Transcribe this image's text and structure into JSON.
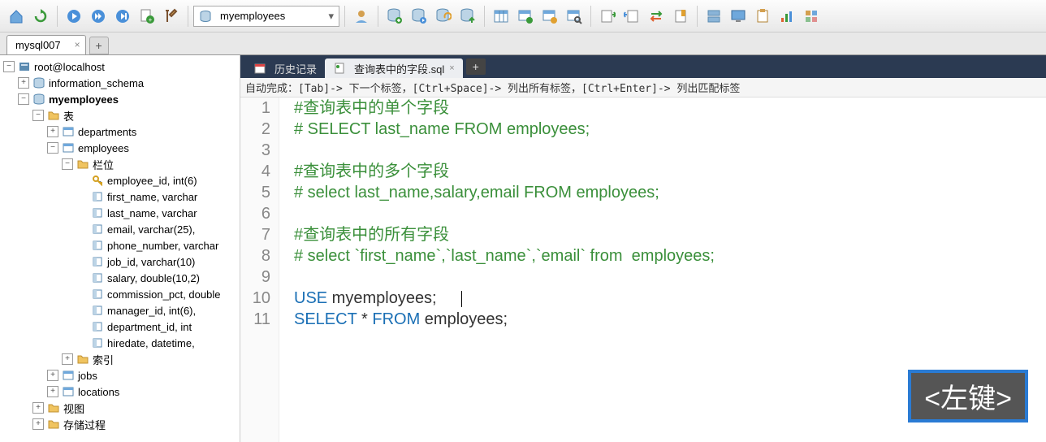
{
  "toolbar": {
    "db_selected": "myemployees"
  },
  "conn_tab": {
    "label": "mysql007"
  },
  "tree": {
    "root": "root@localhost",
    "sys_db": "information_schema",
    "db": "myemployees",
    "tables_label": "表",
    "t_departments": "departments",
    "t_employees": "employees",
    "cols_label": "栏位",
    "cols": [
      "employee_id, int(6)",
      "first_name, varchar",
      "last_name, varchar",
      "email, varchar(25),",
      "phone_number, varchar",
      "job_id, varchar(10)",
      "salary, double(10,2)",
      "commission_pct, double",
      "manager_id, int(6),",
      "department_id, int",
      "hiredate, datetime,"
    ],
    "index_label": "索引",
    "t_jobs": "jobs",
    "t_locations": "locations",
    "views_label": "视图",
    "procs_label": "存储过程"
  },
  "ed_tabs": {
    "history": "历史记录",
    "active": "查询表中的字段.sql"
  },
  "hint": "自动完成：[Tab]-> 下一个标签，[Ctrl+Space]-> 列出所有标签，[Ctrl+Enter]-> 列出匹配标签",
  "code": {
    "l1": {
      "cm": "#查询表中的单个字段"
    },
    "l2": {
      "cm": "# SELECT last_name FROM employees;"
    },
    "l3": "",
    "l4": {
      "cm": "#查询表中的多个字段"
    },
    "l5": {
      "cm": "# select last_name,salary,email FROM employees;"
    },
    "l6": "",
    "l7": {
      "cm": "#查询表中的所有字段"
    },
    "l8": {
      "cm": "# select `first_name`,`last_name`,`email` from  employees;"
    },
    "l9": "",
    "l10": {
      "kw1": "USE",
      "t1": " myemployees;"
    },
    "l11": {
      "kw1": "SELECT",
      "t1": " * ",
      "kw2": "FROM",
      "t2": " employees;"
    }
  },
  "overlay": "<左键>"
}
